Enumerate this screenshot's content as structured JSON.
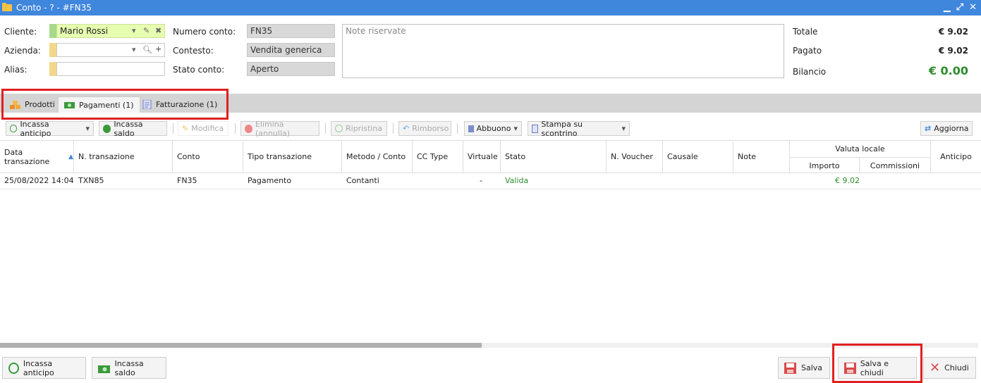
{
  "window": {
    "title": "Conto - ? - #FN35",
    "controls": [
      "▁",
      "⤢",
      "✕"
    ]
  },
  "form": {
    "cliente_label": "Cliente:",
    "cliente_value": "Mario Rossi",
    "azienda_label": "Azienda:",
    "azienda_value": "",
    "alias_label": "Alias:",
    "alias_value": "",
    "numero_label": "Numero conto:",
    "numero_value": "FN35",
    "contesto_label": "Contesto:",
    "contesto_value": "Vendita generica",
    "stato_label": "Stato conto:",
    "stato_value": "Aperto",
    "notes_placeholder": "Note riservate"
  },
  "summary": {
    "totale_label": "Totale",
    "totale_value": "€ 9.02",
    "pagato_label": "Pagato",
    "pagato_value": "€ 9.02",
    "bilancio_label": "Bilancio",
    "bilancio_value": "€ 0.00"
  },
  "tabs": [
    {
      "label": "Prodotti"
    },
    {
      "label": "Pagamenti (1)"
    },
    {
      "label": "Fatturazione (1)"
    }
  ],
  "toolbar": {
    "incassa_anticipo": "Incassa anticipo",
    "incassa_saldo": "Incassa saldo",
    "modifica": "Modifica",
    "elimina": "Elimina (annulla)",
    "ripristina": "Ripristina",
    "rimborso": "Rimborso",
    "abbuono": "Abbuono",
    "stampa": "Stampa su scontrino",
    "aggiorna": "Aggiorna"
  },
  "table": {
    "headers": {
      "data": "Data transazione",
      "n_trans": "N. transazione",
      "conto": "Conto",
      "tipo": "Tipo transazione",
      "metodo": "Metodo / Conto",
      "cc_type": "CC Type",
      "virtuale": "Virtuale",
      "stato": "Stato",
      "voucher": "N. Voucher",
      "causale": "Causale",
      "note": "Note",
      "valuta": "Valuta locale",
      "importo": "Importo",
      "commissioni": "Commissioni",
      "anticipo": "Anticipo"
    },
    "rows": [
      {
        "data": "25/08/2022 14:04",
        "n_trans": "TXN85",
        "conto": "FN35",
        "tipo": "Pagamento",
        "metodo": "Contanti",
        "virtuale": "-",
        "stato": "Valida",
        "importo": "€ 9.02"
      }
    ]
  },
  "footer": {
    "incassa_anticipo": "Incassa anticipo",
    "incassa_saldo": "Incassa saldo",
    "salva": "Salva",
    "salva_chiudi": "Salva e chiudi",
    "chiudi": "Chiudi"
  },
  "colors": {
    "accent": "#3f86dd",
    "highlight": "#e02020",
    "positive": "#2e8b2e"
  }
}
